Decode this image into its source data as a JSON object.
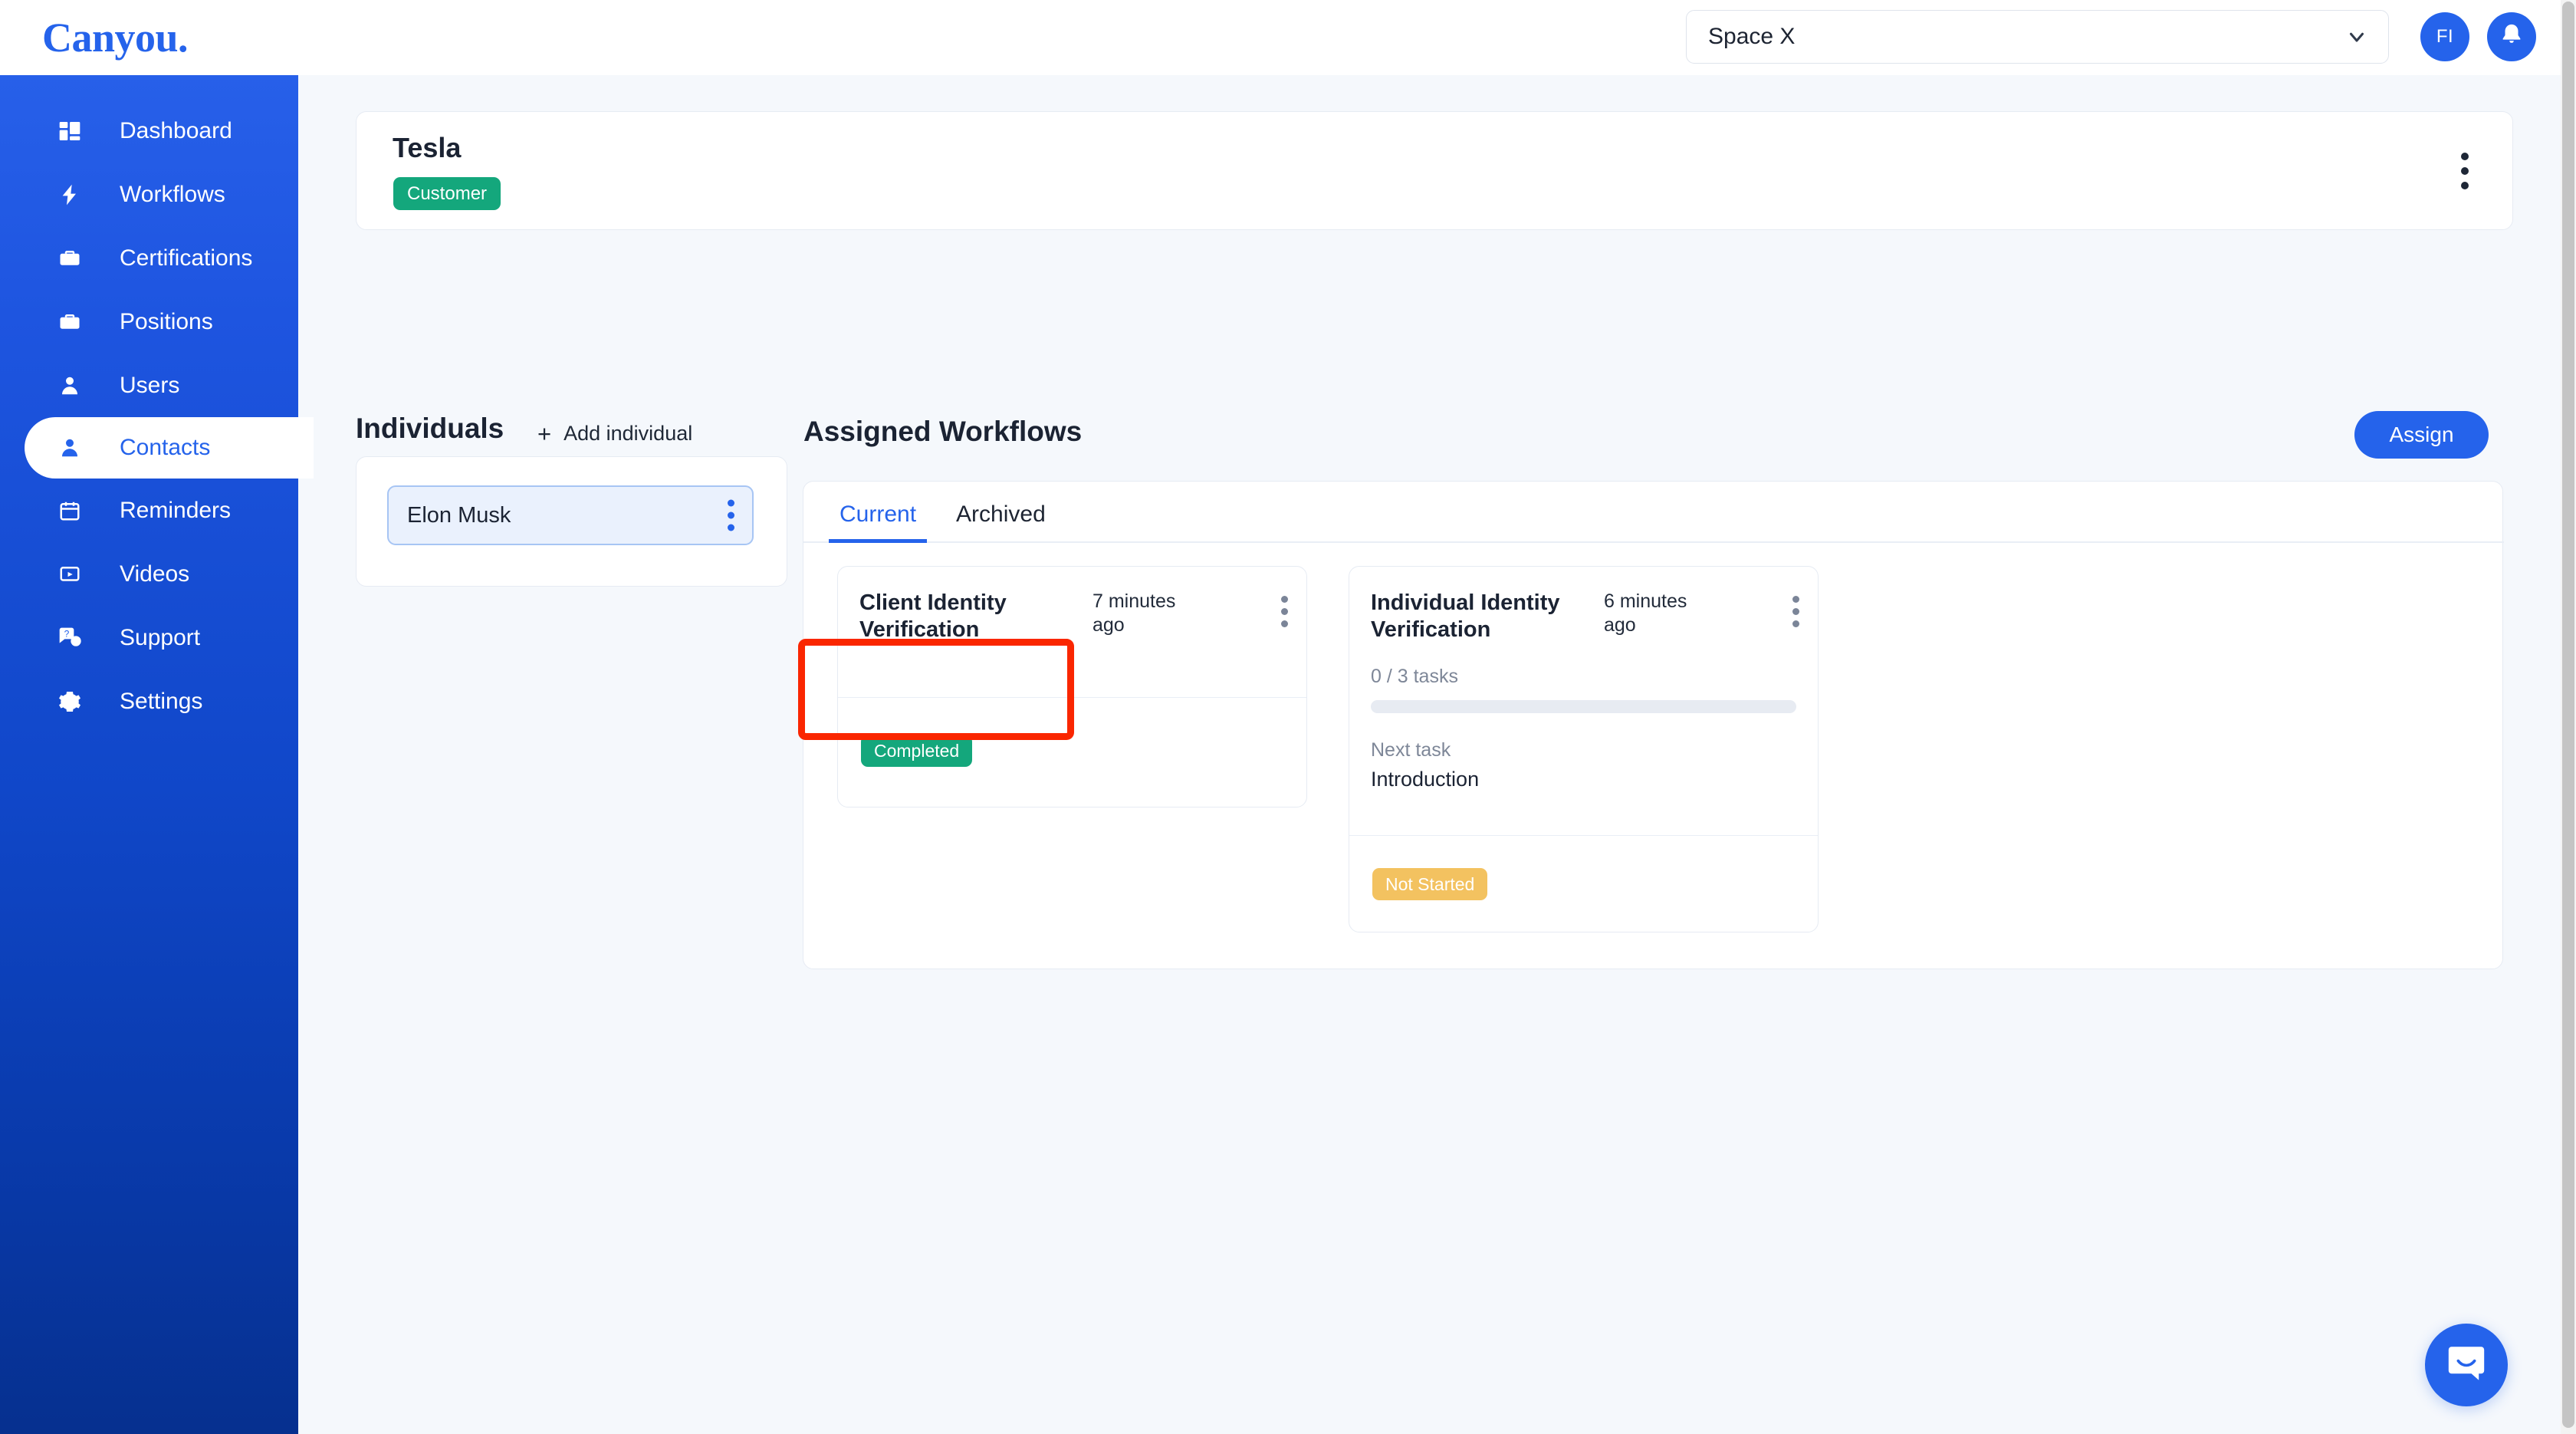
{
  "brand": {
    "logo_text": "Canyou.",
    "accent_blue": "#2563eb",
    "success_green": "#14a77c",
    "warning_amber": "#f3c260",
    "annotation_red": "#fa2600"
  },
  "sidebar": {
    "items": [
      {
        "label": "Dashboard",
        "icon": "dashboard-icon",
        "active": false
      },
      {
        "label": "Workflows",
        "icon": "lightning-icon",
        "active": false
      },
      {
        "label": "Certifications",
        "icon": "briefcase-icon",
        "active": false
      },
      {
        "label": "Positions",
        "icon": "briefcase-icon",
        "active": false
      },
      {
        "label": "Users",
        "icon": "user-icon",
        "active": false
      },
      {
        "label": "Contacts",
        "icon": "user-icon",
        "active": true
      },
      {
        "label": "Reminders",
        "icon": "calendar-icon",
        "active": false
      },
      {
        "label": "Videos",
        "icon": "video-icon",
        "active": false
      },
      {
        "label": "Support",
        "icon": "question-chat-icon",
        "active": false
      },
      {
        "label": "Settings",
        "icon": "gear-icon",
        "active": false
      }
    ]
  },
  "topbar": {
    "org_selected": "Space X",
    "avatar_initials": "FI",
    "notification_icon": "bell-icon",
    "chevron_icon": "chevron-down-icon"
  },
  "entity": {
    "name": "Tesla",
    "badge": "Customer",
    "menu_icon": "kebab-menu-icon"
  },
  "individuals": {
    "title": "Individuals",
    "add_label": "Add individual",
    "add_icon": "plus-icon",
    "rows": [
      {
        "name": "Elon Musk",
        "menu_icon": "kebab-menu-icon",
        "selected": true
      }
    ]
  },
  "workflows": {
    "title": "Assigned Workflows",
    "assign_label": "Assign",
    "tabs": [
      {
        "label": "Current",
        "active": true
      },
      {
        "label": "Archived",
        "active": false
      }
    ],
    "cards": [
      {
        "name": "Client Identity Verification",
        "time": "7 minutes ago",
        "status": "Completed",
        "menu_icon": "kebab-menu-icon"
      },
      {
        "name": "Individual Identity Verification",
        "time": "6 minutes ago",
        "tasks": "0 / 3 tasks",
        "progress_percent": 0,
        "next_task_label": "Next task",
        "next_task_value": "Introduction",
        "status": "Not Started",
        "menu_icon": "kebab-menu-icon"
      }
    ]
  },
  "intercom": {
    "icon": "chat-bubble-icon"
  }
}
